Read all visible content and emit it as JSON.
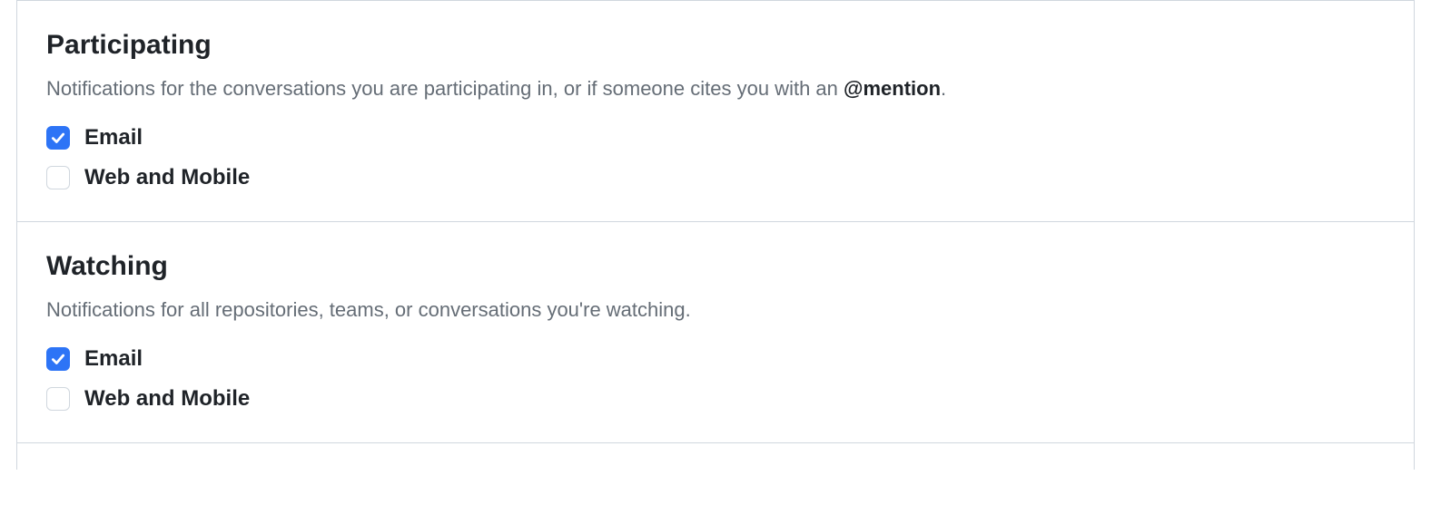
{
  "sections": {
    "participating": {
      "title": "Participating",
      "description_pre": "Notifications for the conversations you are participating in, or if someone cites you with an ",
      "description_mention": "@mention",
      "description_post": ".",
      "options": {
        "email": {
          "label": "Email",
          "checked": true
        },
        "web_mobile": {
          "label": "Web and Mobile",
          "checked": false
        }
      }
    },
    "watching": {
      "title": "Watching",
      "description": "Notifications for all repositories, teams, or conversations you're watching.",
      "options": {
        "email": {
          "label": "Email",
          "checked": true
        },
        "web_mobile": {
          "label": "Web and Mobile",
          "checked": false
        }
      }
    }
  }
}
